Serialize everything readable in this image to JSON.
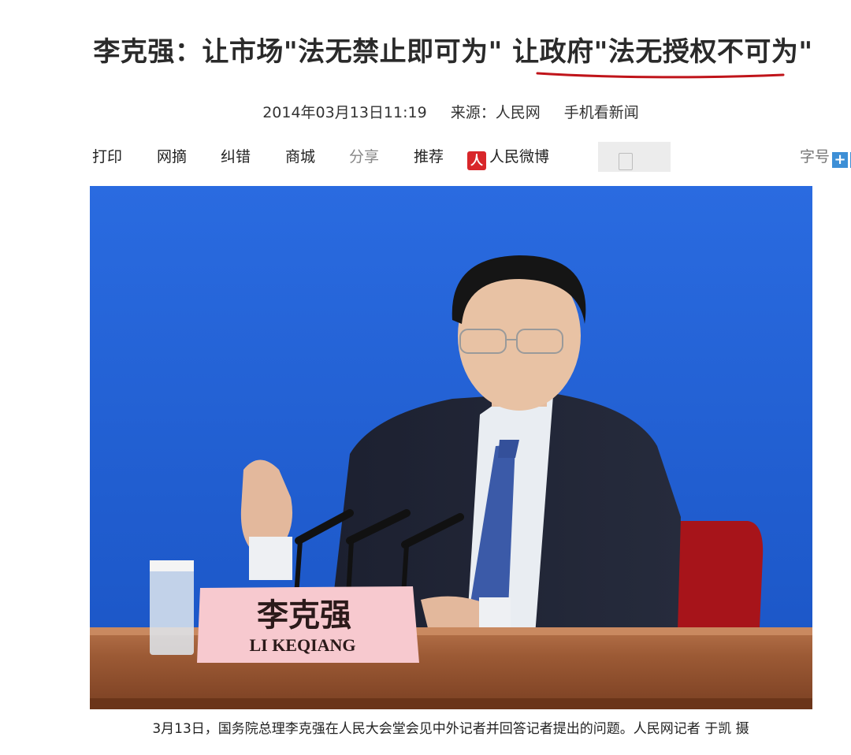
{
  "article": {
    "title": "李克强：让市场\"法无禁止即可为\" 让政府\"法无授权不可为\"",
    "date": "2014年03月13日11:19",
    "source": "来源：人民网",
    "mobile_link": "手机看新闻"
  },
  "toolbar": {
    "print": "打印",
    "excerpt": "网摘",
    "correct": "纠错",
    "mall": "商城",
    "share": "分享",
    "recommend": "推荐",
    "weibo_logo": "人",
    "weibo": "人民微博",
    "font_size": "字号",
    "increase": "+",
    "decrease": "−"
  },
  "photo": {
    "nameplate_cn": "李克强",
    "nameplate_en": "LI KEQIANG"
  },
  "caption": "3月13日，国务院总理李克强在人民大会堂会见中外记者并回答记者提出的问题。人民网记者 于凯 摄",
  "colors": {
    "backdrop_blue": "#1f5fd3",
    "underline_red": "#c0141a",
    "font_btn_blue": "#3d8fd6",
    "weibo_red": "#d8262a"
  }
}
